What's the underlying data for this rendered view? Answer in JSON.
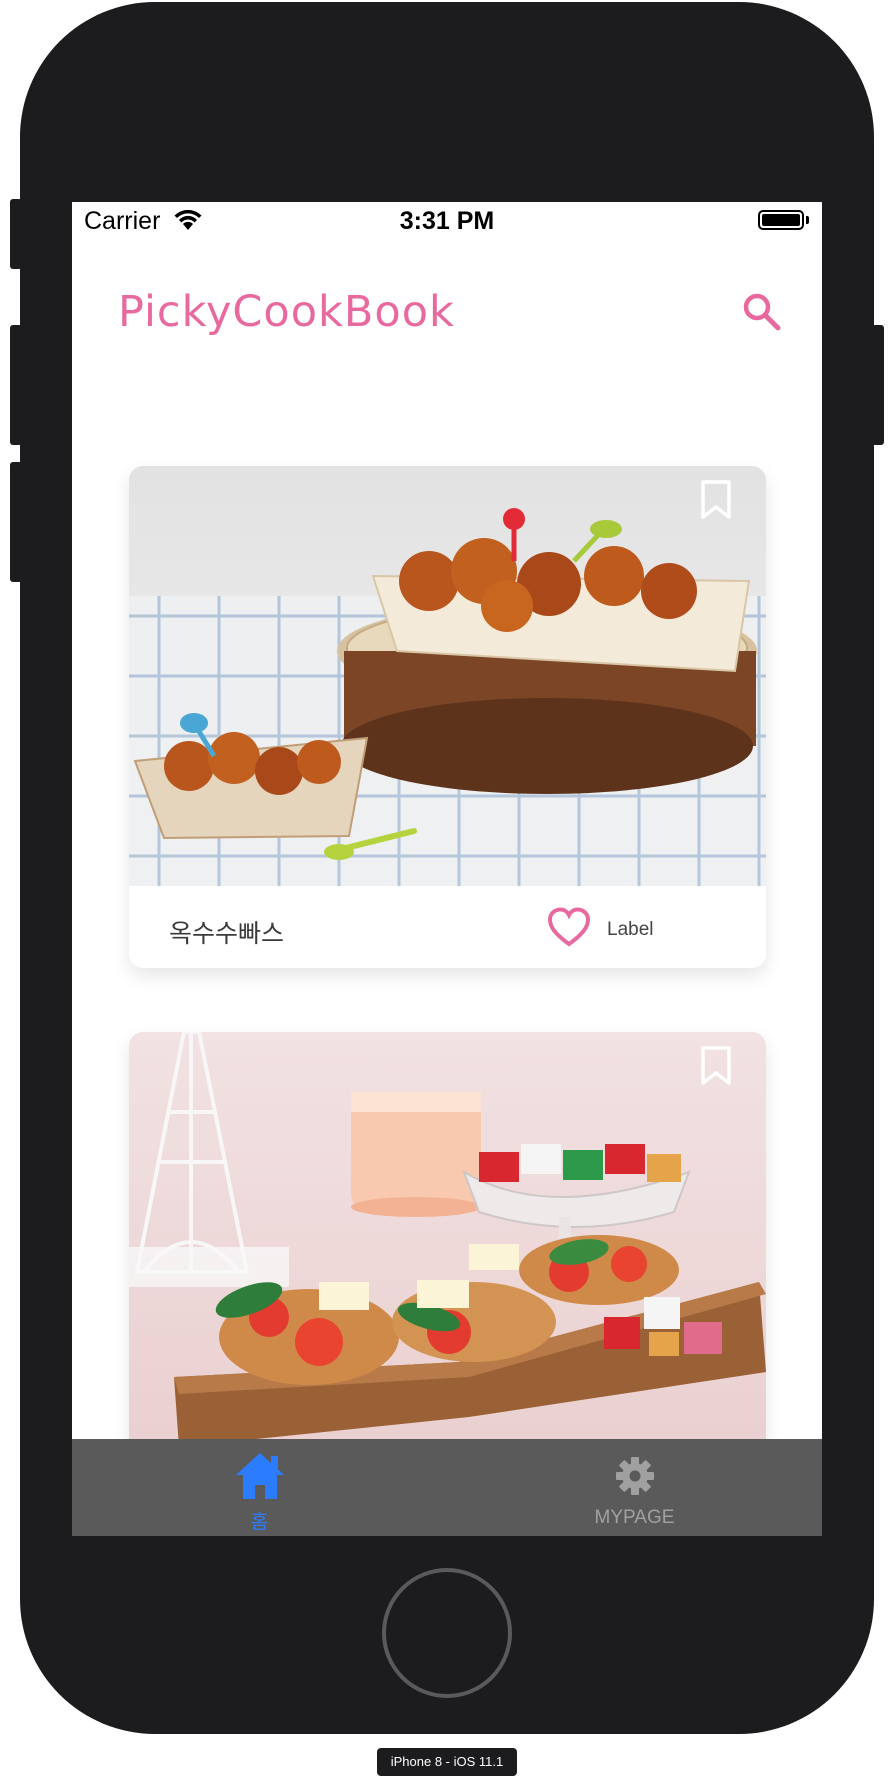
{
  "status_bar": {
    "carrier": "Carrier",
    "time": "3:31 PM"
  },
  "header": {
    "title": "PickyCookBook",
    "search_icon": "search-icon"
  },
  "feed": {
    "cards": [
      {
        "recipe_name": "옥수수빠스",
        "like_label": "Label",
        "image": "sweet-fried-chicken-photo",
        "bookmark_icon": "bookmark-icon",
        "like_icon": "heart-icon"
      },
      {
        "image": "bruschetta-photo",
        "bookmark_icon": "bookmark-icon"
      }
    ]
  },
  "tab_bar": {
    "tabs": [
      {
        "label": "홈",
        "icon": "home-icon",
        "selected": true
      },
      {
        "label": "MYPAGE",
        "icon": "gear-icon",
        "selected": false
      }
    ]
  },
  "device": {
    "label": "iPhone 8 - iOS 11.1"
  },
  "colors": {
    "accent_pink": "#e8699f",
    "tab_selected": "#2b7cff",
    "tab_unselected": "#a0a0a0",
    "tab_bar_bg": "#5a5a5a",
    "device_frame": "#1c1c1e"
  }
}
